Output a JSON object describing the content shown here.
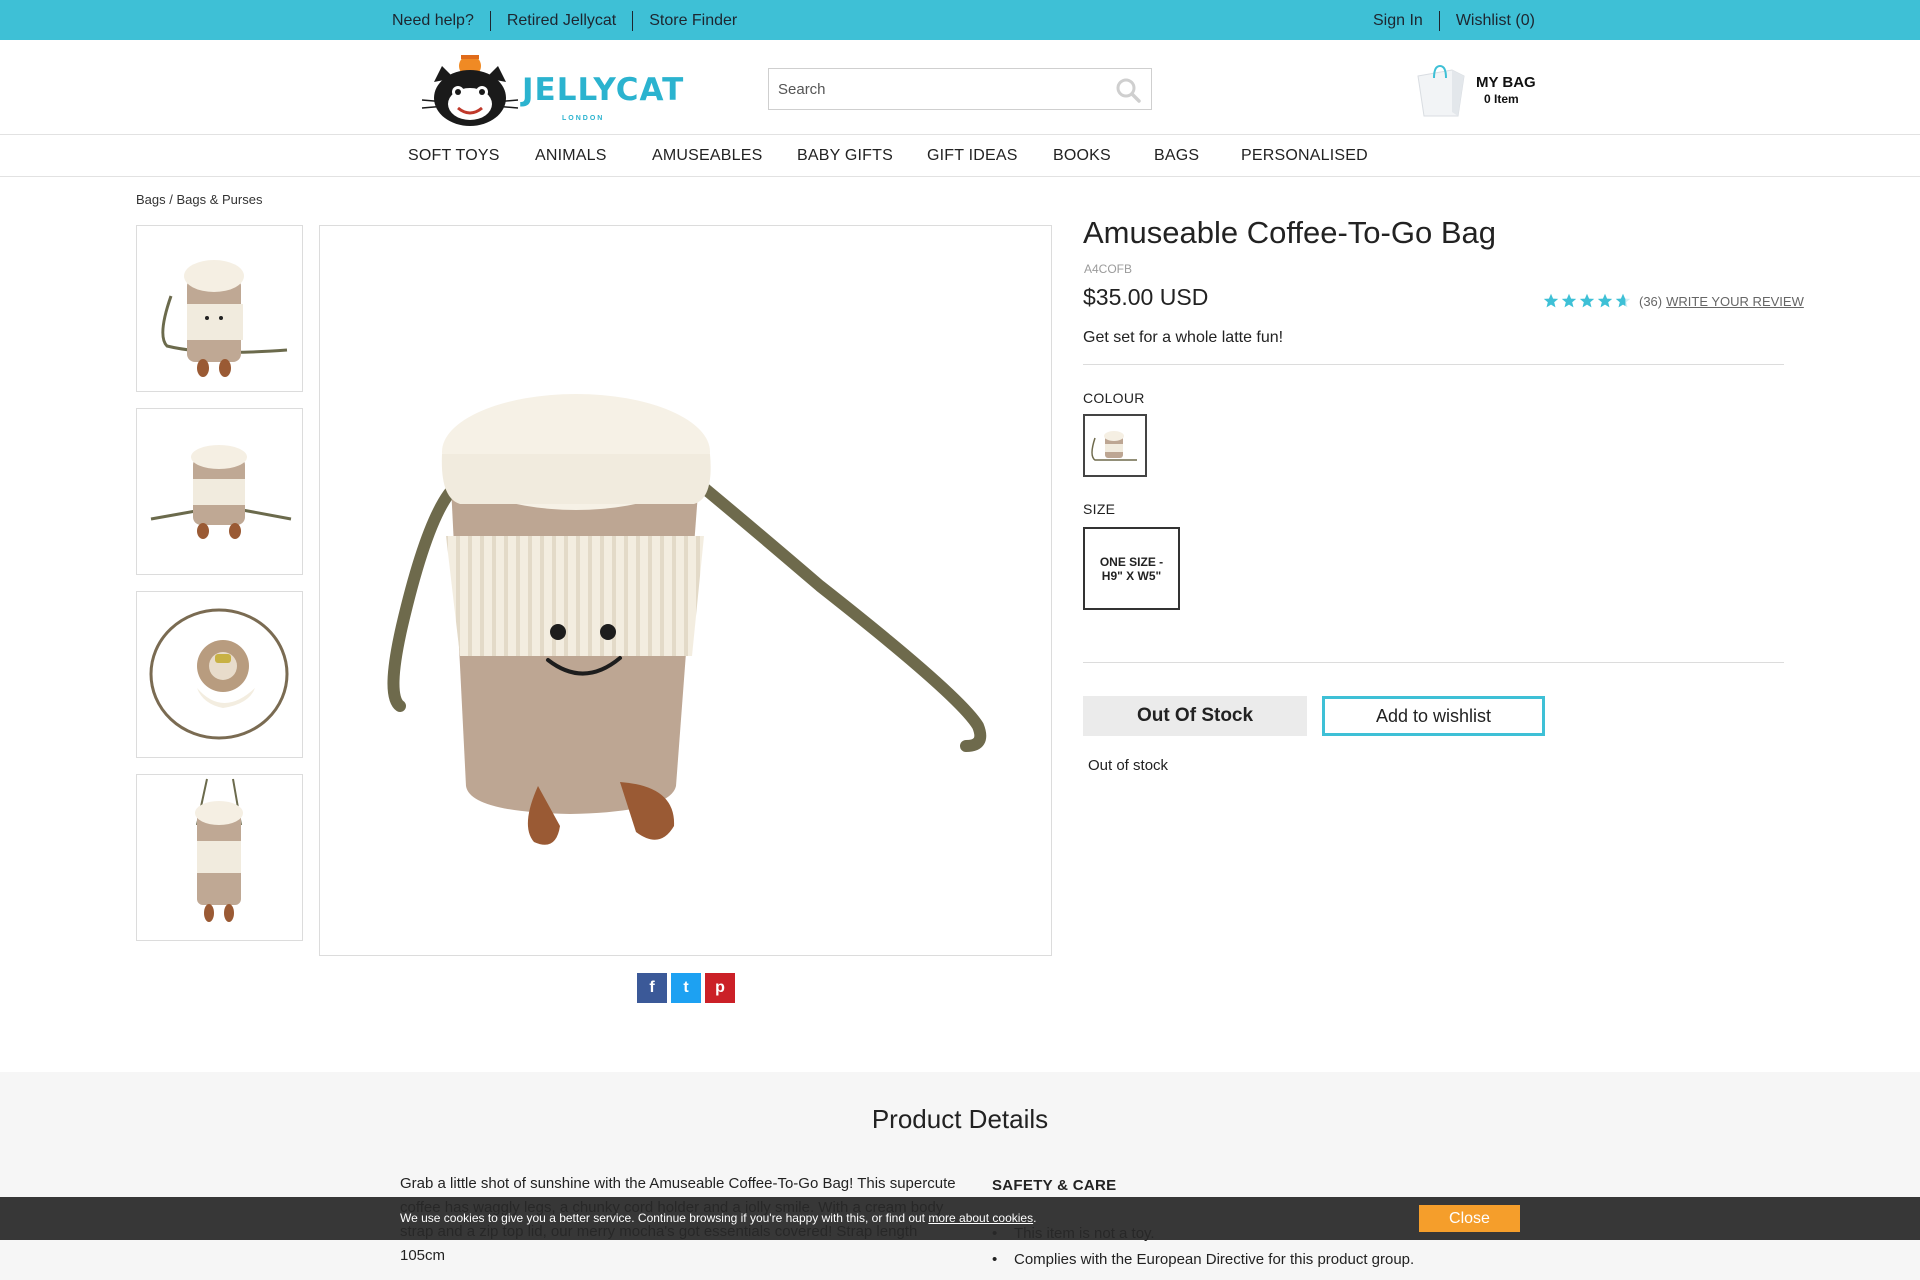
{
  "topbar": {
    "need_help": "Need help?",
    "retired": "Retired Jellycat",
    "store_finder": "Store Finder",
    "sign_in": "Sign In",
    "wishlist": "Wishlist (0)"
  },
  "header": {
    "logo_text": "JELLYCAT",
    "logo_sub": "LONDON",
    "search_placeholder": "Search",
    "bag_title": "MY BAG",
    "bag_count": "0 Item"
  },
  "nav": [
    "SOFT TOYS",
    "ANIMALS",
    "AMUSEABLES",
    "BABY GIFTS",
    "GIFT IDEAS",
    "BOOKS",
    "BAGS",
    "PERSONALISED"
  ],
  "breadcrumb": "Bags / Bags & Purses",
  "product": {
    "title": "Amuseable Coffee-To-Go Bag",
    "sku": "A4COFB",
    "price": "$35.00 USD",
    "rating": 4.5,
    "review_count": "(36)",
    "write_review": "WRITE YOUR REVIEW",
    "tagline": "Get set for a whole latte fun!",
    "colour_label": "COLOUR",
    "size_label": "SIZE",
    "size_value": "ONE SIZE - H9\" X W5\"",
    "out_of_stock_btn": "Out Of Stock",
    "wishlist_btn": "Add to wishlist",
    "stock_msg": "Out of stock"
  },
  "share": {
    "facebook": "f",
    "twitter": "t",
    "pinterest": "p"
  },
  "details": {
    "heading": "Product Details",
    "description": "Grab a little shot of sunshine with the Amuseable Coffee-To-Go Bag! This supercute coffee has waggly legs, a chunky cord holder and a jolly smile. With a cream body strap and a zip top lid, our merry mocha's got essentials covered! Strap length 105cm",
    "safety_title": "SAFETY & CARE",
    "safety_items": [
      "This item is not a toy.",
      "Complies with the European Directive for this product group."
    ]
  },
  "cookie": {
    "message": "We use cookies to give you a better service. Continue browsing if you're happy with this, or find out",
    "link": "more about cookies",
    "close": "Close"
  },
  "colors": {
    "accent": "#3ec0d6",
    "cookie_close": "#f59e2b"
  }
}
